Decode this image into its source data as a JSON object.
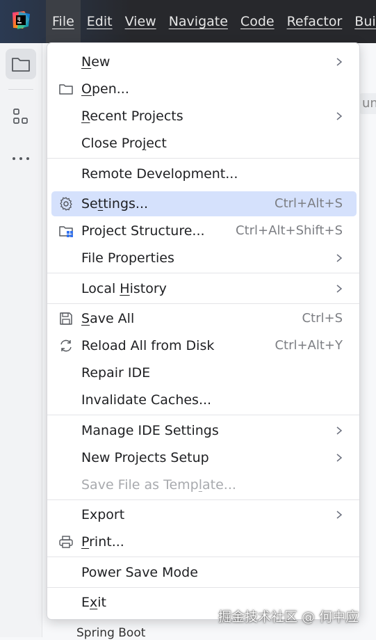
{
  "menubar": {
    "items": [
      "File",
      "Edit",
      "View",
      "Navigate",
      "Code",
      "Refactor",
      "Build"
    ]
  },
  "editor": {
    "tab_fragment": "un",
    "bottom_fragment": "Spring Boot"
  },
  "file_menu": {
    "new": {
      "pre": "",
      "mn": "N",
      "post": "ew"
    },
    "open": {
      "pre": "",
      "mn": "O",
      "post": "pen..."
    },
    "recent_projects": {
      "pre": "",
      "mn": "R",
      "post": "ecent Projects"
    },
    "close_project": {
      "pre": "Close Pro",
      "mn": "j",
      "post": "ect"
    },
    "remote_development": {
      "label": "Remote Development..."
    },
    "settings": {
      "pre": "Se",
      "mn": "t",
      "post": "tings...",
      "shortcut": "Ctrl+Alt+S"
    },
    "project_structure": {
      "label": "Project Structure...",
      "shortcut": "Ctrl+Alt+Shift+S"
    },
    "file_properties": {
      "label": "File Properties"
    },
    "local_history": {
      "pre": "Local ",
      "mn": "H",
      "post": "istory"
    },
    "save_all": {
      "pre": "",
      "mn": "S",
      "post": "ave All",
      "shortcut": "Ctrl+S"
    },
    "reload_all": {
      "label": "Reload All from Disk",
      "shortcut": "Ctrl+Alt+Y"
    },
    "repair_ide": {
      "label": "Repair IDE"
    },
    "invalidate_caches": {
      "label": "Invalidate Caches..."
    },
    "manage_ide_settings": {
      "label": "Manage IDE Settings"
    },
    "new_projects_setup": {
      "label": "New Projects Setup"
    },
    "save_file_as_template": {
      "pre": "Save File as Temp",
      "mn": "l",
      "post": "ate..."
    },
    "export": {
      "label": "Export"
    },
    "print": {
      "pre": "",
      "mn": "P",
      "post": "rint..."
    },
    "power_save_mode": {
      "label": "Power Save Mode"
    },
    "exit": {
      "pre": "E",
      "mn": "x",
      "post": "it"
    }
  },
  "watermark": "掘金技术社区 @ 何中应",
  "colors": {
    "highlight": "#d5e1fc",
    "topbar": "#27282c",
    "accent_blue": "#3574f0"
  },
  "icons": {
    "logo": "intellij-logo-icon",
    "folder": "folder-icon",
    "structure": "structure-icon",
    "more": "more-icon",
    "gear": "gear-icon",
    "project_structure": "project-structure-icon",
    "save": "save-icon",
    "reload": "reload-icon",
    "print": "printer-icon",
    "chevron": "chevron-right-icon"
  }
}
